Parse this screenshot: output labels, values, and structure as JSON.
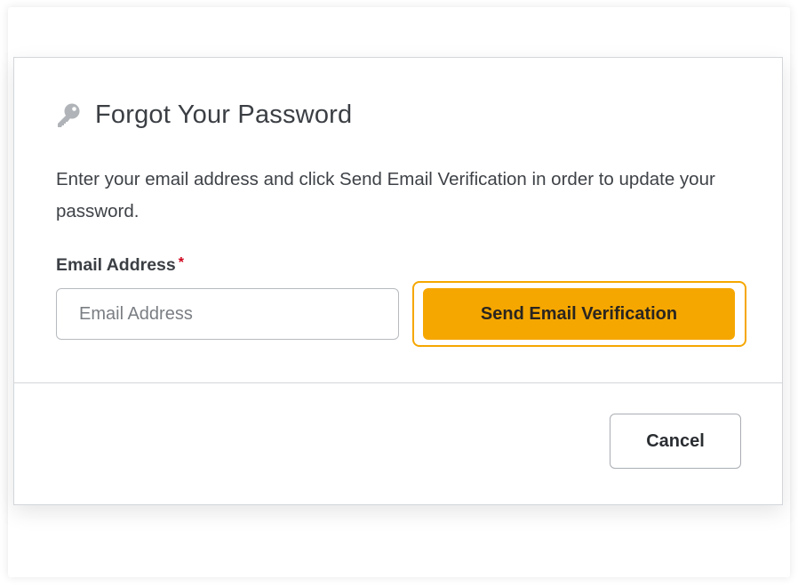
{
  "dialog": {
    "title": "Forgot Your Password",
    "title_icon": "key-icon",
    "description": "Enter your email address and click Send Email Verification in order to update your password.",
    "email_field": {
      "label": "Email Address",
      "required_marker": "*",
      "placeholder": "Email Address",
      "value": ""
    },
    "send_button_label": "Send Email Verification",
    "cancel_button_label": "Cancel"
  },
  "colors": {
    "accent": "#f5a700",
    "required": "#d0021b",
    "icon": "#b0b4b8"
  }
}
